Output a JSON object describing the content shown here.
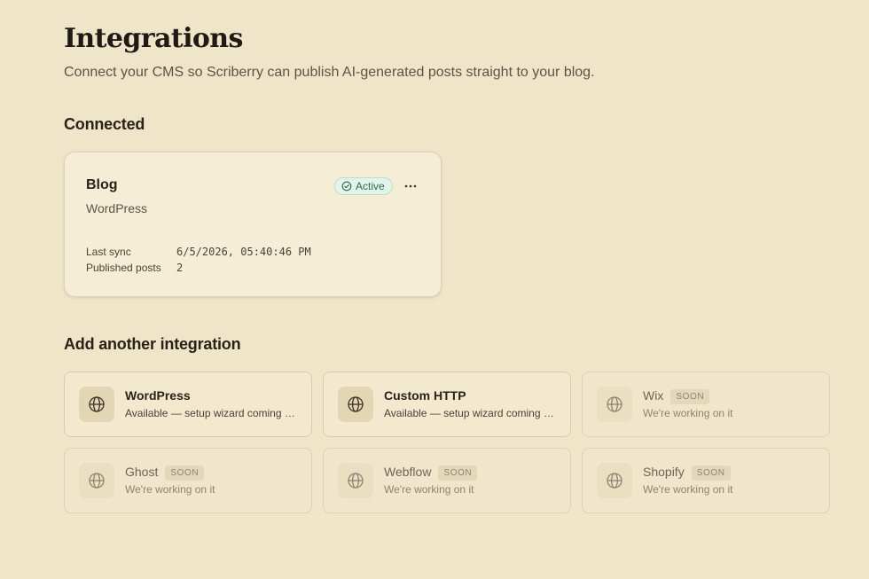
{
  "header": {
    "title": "Integrations",
    "subtitle": "Connect your CMS so Scriberry can publish AI-generated posts straight to your blog."
  },
  "connected": {
    "section_title": "Connected",
    "card": {
      "name": "Blog",
      "provider": "WordPress",
      "status": "Active",
      "status_color": "#2e6b4f",
      "last_sync_label": "Last sync",
      "last_sync_value": "6/5/2026, 05:40:46 PM",
      "posts_label": "Published posts",
      "posts_value": "2"
    }
  },
  "add": {
    "section_title": "Add another integration",
    "soon_label": "SOON",
    "tiles": [
      {
        "name": "WordPress",
        "desc": "Available — setup wizard coming soon",
        "icon": "globe-icon",
        "state": "available"
      },
      {
        "name": "Custom HTTP",
        "desc": "Available — setup wizard coming soon",
        "icon": "globe-icon",
        "state": "available"
      },
      {
        "name": "Wix",
        "desc": "We're working on it",
        "icon": "globe-icon",
        "state": "soon"
      },
      {
        "name": "Ghost",
        "desc": "We're working on it",
        "icon": "globe-icon",
        "state": "soon"
      },
      {
        "name": "Webflow",
        "desc": "We're working on it",
        "icon": "globe-icon",
        "state": "soon"
      },
      {
        "name": "Shopify",
        "desc": "We're working on it",
        "icon": "globe-icon",
        "state": "soon"
      }
    ]
  }
}
